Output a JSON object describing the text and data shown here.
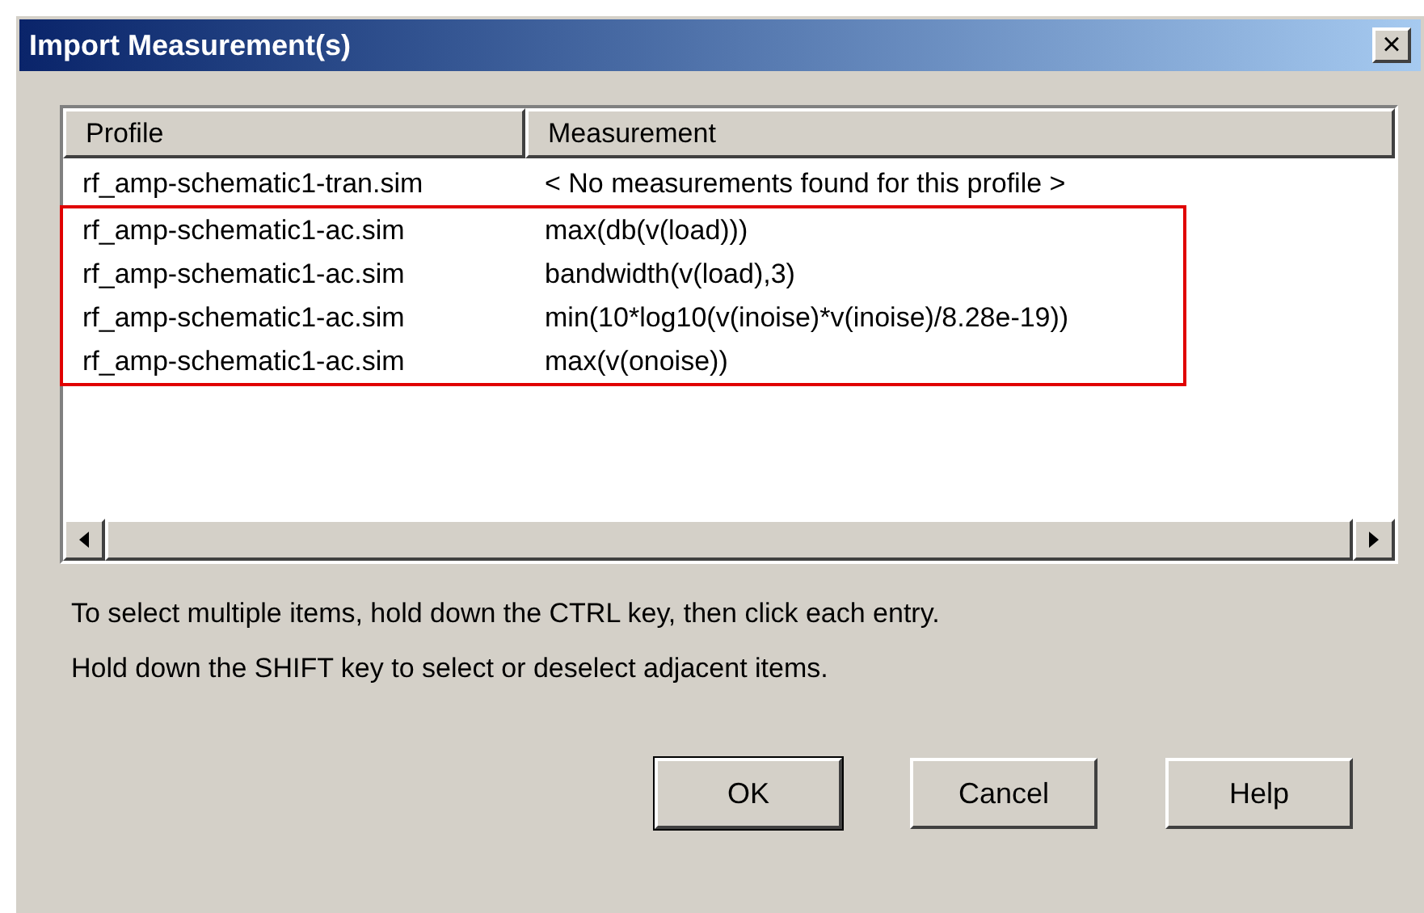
{
  "window": {
    "title": "Import Measurement(s)",
    "close": "×"
  },
  "table": {
    "columns": [
      "Profile",
      "Measurement"
    ],
    "rows": [
      {
        "profile": "rf_amp-schematic1-tran.sim",
        "measurement": "< No measurements found for this profile >",
        "highlighted": false
      },
      {
        "profile": "rf_amp-schematic1-ac.sim",
        "measurement": "max(db(v(load)))",
        "highlighted": true
      },
      {
        "profile": "rf_amp-schematic1-ac.sim",
        "measurement": "bandwidth(v(load),3)",
        "highlighted": true
      },
      {
        "profile": "rf_amp-schematic1-ac.sim",
        "measurement": "min(10*log10(v(inoise)*v(inoise)/8.28e-19))",
        "highlighted": true
      },
      {
        "profile": "rf_amp-schematic1-ac.sim",
        "measurement": "max(v(onoise))",
        "highlighted": true
      }
    ]
  },
  "hints": [
    "To select multiple items, hold down the CTRL key, then click each entry.",
    "Hold down the SHIFT key to select or deselect adjacent items."
  ],
  "buttons": [
    {
      "label": "OK",
      "default": true
    },
    {
      "label": "Cancel",
      "default": false
    },
    {
      "label": "Help",
      "default": false
    }
  ]
}
